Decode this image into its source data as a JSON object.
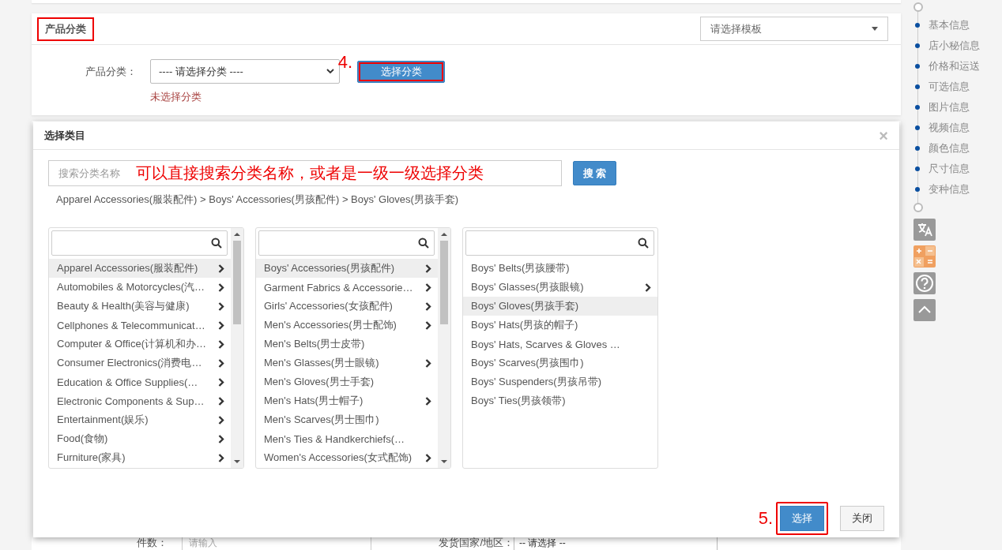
{
  "form_card": {
    "title": "产品分类",
    "title_highlighted": true,
    "template_select": {
      "placeholder": "请选择模板"
    },
    "field_label": "产品分类：",
    "category_select": {
      "value": "---- 请选择分类 ----"
    },
    "choose_button": {
      "label": "选择分类",
      "highlighted": true,
      "step_label": "4."
    },
    "error": "未选择分类"
  },
  "bottom_form": {
    "quantity_label": "件数：",
    "quantity_placeholder": "请输入",
    "country_label": "发货国家/地区：",
    "country_select": {
      "value": "-- 请选择 --"
    }
  },
  "side_nav": {
    "items": [
      {
        "label": "基本信息"
      },
      {
        "label": "店小秘信息"
      },
      {
        "label": "价格和运送"
      },
      {
        "label": "可选信息"
      },
      {
        "label": "图片信息"
      },
      {
        "label": "视频信息"
      },
      {
        "label": "颜色信息"
      },
      {
        "label": "尺寸信息"
      },
      {
        "label": "变种信息"
      }
    ]
  },
  "dialog": {
    "title": "选择类目",
    "close": "×",
    "search": {
      "placeholder": "搜索分类名称"
    },
    "annotation": "可以直接搜索分类名称，或者是一级一级选择分类",
    "search_button": "搜 索",
    "breadcrumb": "Apparel Accessories(服装配件) > Boys' Accessories(男孩配件) > Boys' Gloves(男孩手套)",
    "columns": [
      {
        "items": [
          {
            "label": "Apparel Accessories(服装配件)",
            "has_children": true,
            "selected": true
          },
          {
            "label": "Automobiles & Motorcycles(汽…",
            "has_children": true,
            "selected": false
          },
          {
            "label": "Beauty & Health(美容与健康)",
            "has_children": true,
            "selected": false
          },
          {
            "label": "Cellphones & Telecommunicat…",
            "has_children": true,
            "selected": false
          },
          {
            "label": "Computer & Office(计算机和办…",
            "has_children": true,
            "selected": false
          },
          {
            "label": "Consumer Electronics(消费电…",
            "has_children": true,
            "selected": false
          },
          {
            "label": "Education & Office Supplies(…",
            "has_children": true,
            "selected": false
          },
          {
            "label": "Electronic Components & Sup…",
            "has_children": true,
            "selected": false
          },
          {
            "label": "Entertainment(娱乐)",
            "has_children": true,
            "selected": false
          },
          {
            "label": "Food(食物)",
            "has_children": true,
            "selected": false
          },
          {
            "label": "Furniture(家具)",
            "has_children": true,
            "selected": false
          }
        ]
      },
      {
        "items": [
          {
            "label": "Boys' Accessories(男孩配件)",
            "has_children": true,
            "selected": true
          },
          {
            "label": "Garment Fabrics & Accessorie…",
            "has_children": true,
            "selected": false
          },
          {
            "label": "Girls' Accessories(女孩配件)",
            "has_children": true,
            "selected": false
          },
          {
            "label": "Men's Accessories(男士配饰)",
            "has_children": true,
            "selected": false
          },
          {
            "label": "Men's Belts(男士皮带)",
            "has_children": false,
            "selected": false
          },
          {
            "label": "Men's Glasses(男士眼镜)",
            "has_children": true,
            "selected": false
          },
          {
            "label": "Men's Gloves(男士手套)",
            "has_children": false,
            "selected": false
          },
          {
            "label": "Men's Hats(男士帽子)",
            "has_children": true,
            "selected": false
          },
          {
            "label": "Men's Scarves(男士围巾)",
            "has_children": false,
            "selected": false
          },
          {
            "label": "Men's Ties & Handkerchiefs(…",
            "has_children": false,
            "selected": false
          },
          {
            "label": "Women's Accessories(女式配饰)",
            "has_children": true,
            "selected": false
          }
        ]
      },
      {
        "items": [
          {
            "label": "Boys' Belts(男孩腰带)",
            "has_children": false,
            "selected": false
          },
          {
            "label": "Boys' Glasses(男孩眼镜)",
            "has_children": true,
            "selected": false
          },
          {
            "label": "Boys' Gloves(男孩手套)",
            "has_children": false,
            "selected": true
          },
          {
            "label": "Boys' Hats(男孩的帽子)",
            "has_children": false,
            "selected": false
          },
          {
            "label": "Boys' Hats, Scarves & Gloves …",
            "has_children": false,
            "selected": false
          },
          {
            "label": "Boys' Scarves(男孩围巾)",
            "has_children": false,
            "selected": false
          },
          {
            "label": "Boys' Suspenders(男孩吊带)",
            "has_children": false,
            "selected": false
          },
          {
            "label": "Boys' Ties(男孩领带)",
            "has_children": false,
            "selected": false
          }
        ]
      }
    ],
    "buttons": [
      {
        "label": "选择",
        "kind": "primary",
        "highlighted": true,
        "step_label": "5."
      },
      {
        "label": "关闭",
        "kind": "default",
        "highlighted": false
      }
    ]
  }
}
